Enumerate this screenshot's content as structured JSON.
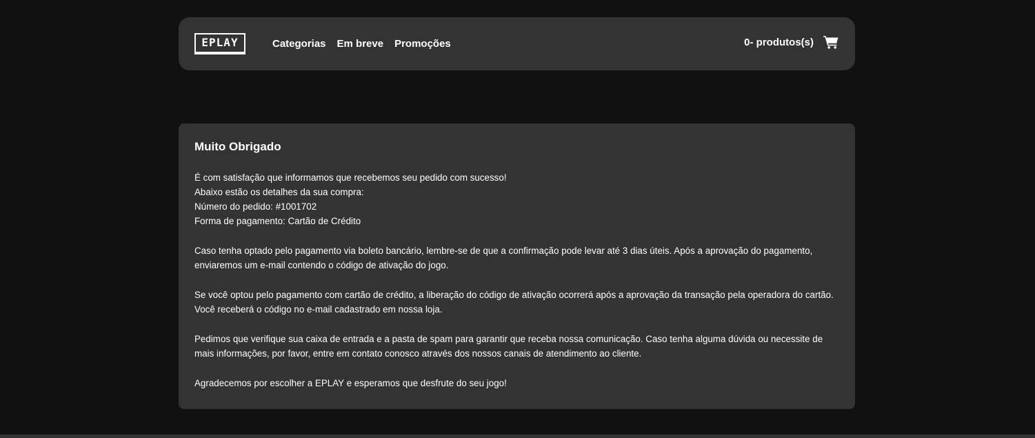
{
  "header": {
    "logo_text": "EPLAY",
    "nav": [
      {
        "label": "Categorias"
      },
      {
        "label": "Em breve"
      },
      {
        "label": "Promoções"
      }
    ],
    "cart_label": "0- produtos(s)",
    "cart_icon": "shopping-cart-icon"
  },
  "main": {
    "title": "Muito Obrigado",
    "intro_lines": [
      "É com satisfação que informamos que recebemos seu pedido com sucesso!",
      "Abaixo estão os detalhes da sua compra:",
      "Número do pedido: #1001702",
      "Forma de pagamento: Cartão de Crédito"
    ],
    "paragraph_boleto": "Caso tenha optado pelo pagamento via boleto bancário, lembre-se de que a confirmação pode levar até 3 dias úteis. Após a aprovação do pagamento, enviaremos um e-mail contendo o código de ativação do jogo.",
    "paragraph_cartao": "Se você optou pelo pagamento com cartão de crédito, a liberação do código de ativação ocorrerá após a aprovação da transação pela operadora do cartão. Você receberá o código no e-mail cadastrado em nossa loja.",
    "paragraph_spam": "Pedimos que verifique sua caixa de entrada e a pasta de spam para garantir que receba nossa comunicação. Caso tenha alguma dúvida ou necessite de mais informações, por favor, entre em contato conosco através dos nossos canais de atendimento ao cliente.",
    "paragraph_thanks": "Agradecemos por escolher a EPLAY e esperamos que desfrute do seu jogo!"
  },
  "colors": {
    "background": "#111111",
    "panel": "#333333",
    "text": "#ffffff"
  }
}
